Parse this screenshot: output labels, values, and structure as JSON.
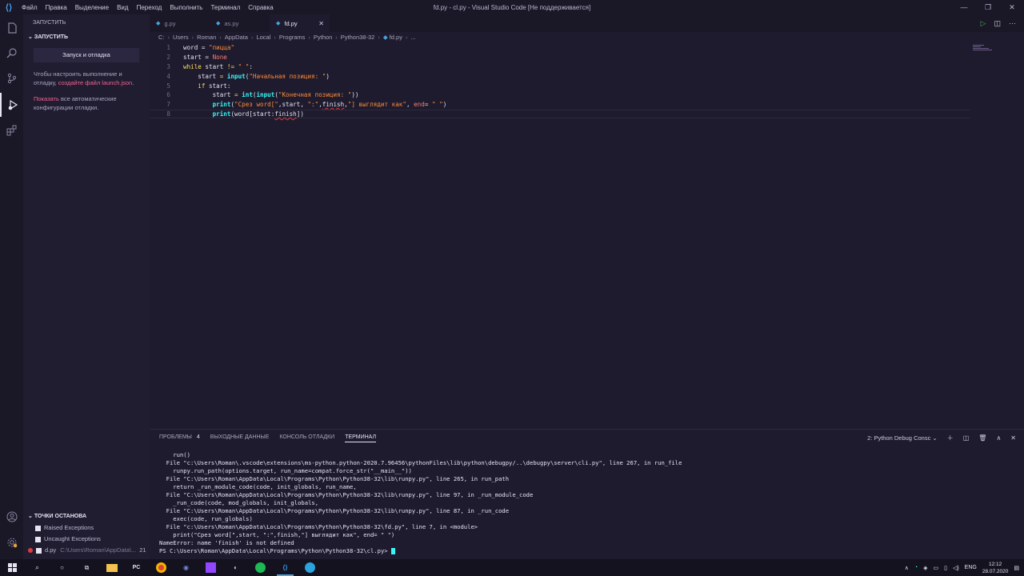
{
  "titlebar": {
    "menu": [
      "Файл",
      "Правка",
      "Выделение",
      "Вид",
      "Переход",
      "Выполнить",
      "Терминал",
      "Справка"
    ],
    "title": "fd.py - cl.py - Visual Studio Code [Не поддерживается]"
  },
  "sidebar": {
    "header": "ЗАПУСТИТЬ",
    "section": "ЗАПУСТИТЬ",
    "run_button": "Запуск и отладка",
    "text1": "Чтобы настроить выполнение и отладку,",
    "link1": "создайте файл launch.json",
    "text1_end": ".",
    "link2": "Показать",
    "text2": "все автоматические конфигурации отладки.",
    "breakpoints": {
      "header": "ТОЧКИ ОСТАНОВА",
      "items": [
        {
          "label": "Raised Exceptions",
          "path": "",
          "line": ""
        },
        {
          "label": "Uncaught Exceptions",
          "path": "",
          "line": ""
        },
        {
          "label": "d.py",
          "path": "C:\\Users\\Roman\\AppData\\...",
          "line": "21"
        }
      ]
    }
  },
  "tabs": [
    {
      "label": "g.py"
    },
    {
      "label": "as.py"
    },
    {
      "label": "fd.py",
      "close": "✕"
    }
  ],
  "breadcrumb": [
    "C:",
    "Users",
    "Roman",
    "AppData",
    "Local",
    "Programs",
    "Python",
    "Python38-32",
    "fd.py",
    "..."
  ],
  "code": {
    "line_numbers": [
      "1",
      "2",
      "3",
      "4",
      "5",
      "6",
      "7",
      "8"
    ]
  },
  "panel": {
    "tabs": [
      "ПРОБЛЕМЫ",
      "ВЫХОДНЫЕ ДАННЫЕ",
      "КОНСОЛЬ ОТЛАДКИ",
      "ТЕРМИНАЛ"
    ],
    "problems_count": "4",
    "terminal_select": "2: Python Debug Consc",
    "terminal_lines": [
      "    run()",
      "  File \"c:\\Users\\Roman\\.vscode\\extensions\\ms-python.python-2020.7.96456\\pythonFiles\\lib\\python\\debugpy/..\\debugpy\\server\\cli.py\", line 267, in run_file",
      "    runpy.run_path(options.target, run_name=compat.force_str(\"__main__\"))",
      "  File \"C:\\Users\\Roman\\AppData\\Local\\Programs\\Python\\Python38-32\\lib\\runpy.py\", line 265, in run_path",
      "    return _run_module_code(code, init_globals, run_name,",
      "  File \"C:\\Users\\Roman\\AppData\\Local\\Programs\\Python\\Python38-32\\lib\\runpy.py\", line 97, in _run_module_code",
      "    _run_code(code, mod_globals, init_globals,",
      "  File \"C:\\Users\\Roman\\AppData\\Local\\Programs\\Python\\Python38-32\\lib\\runpy.py\", line 87, in _run_code",
      "    exec(code, run_globals)",
      "  File \"c:\\Users\\Roman\\AppData\\Local\\Programs\\Python\\Python38-32\\fd.py\", line 7, in <module>",
      "    print(\"Срез word[\",start, \":\",finish,\"] выглядит как\", end= \" \")",
      "NameError: name 'finish' is not defined"
    ],
    "prompt": "PS C:\\Users\\Roman\\AppData\\Local\\Programs\\Python\\Python38-32\\cl.py> "
  },
  "taskbar": {
    "lang": "ENG",
    "time": "12:12",
    "date": "28.07.2020"
  }
}
